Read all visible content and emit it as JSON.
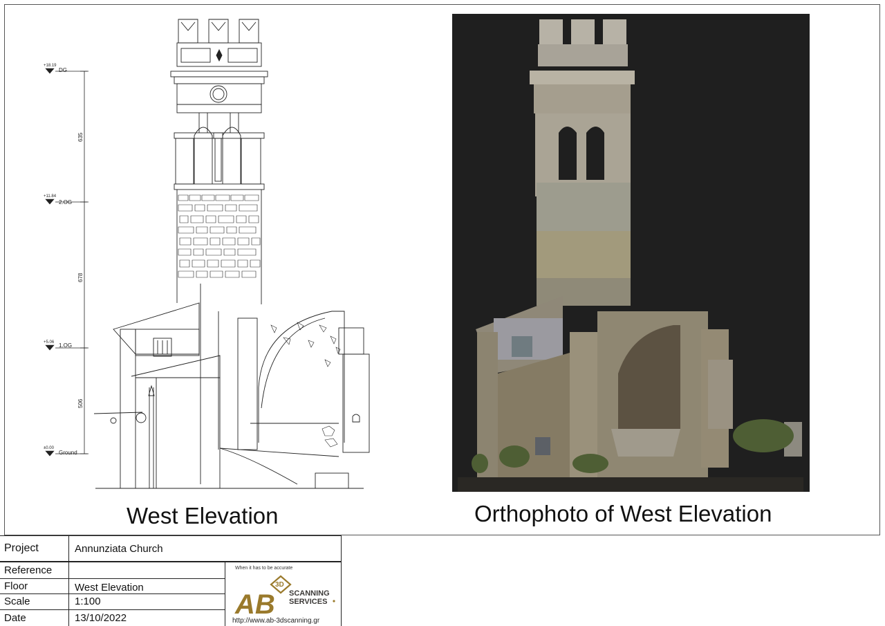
{
  "drawing": {
    "left_caption": "West Elevation",
    "right_caption": "Orthophoto of West  Elevation",
    "levels": [
      {
        "elev": "+18.19",
        "name": "DG"
      },
      {
        "elev": "+11.84",
        "name": "2.OG"
      },
      {
        "elev": "+5.06",
        "name": "1.OG"
      },
      {
        "elev": "±0.00",
        "name": "Ground"
      }
    ],
    "dimensions": [
      "635",
      "678",
      "506"
    ]
  },
  "titleblock": {
    "rows": [
      {
        "label": "Project",
        "value": "Annunziata Church"
      },
      {
        "label": "Reference",
        "value": ""
      },
      {
        "label": "Floor",
        "value": "West Elevation"
      },
      {
        "label": "Scale",
        "value": "1:100"
      },
      {
        "label": "Date",
        "value": "13/10/2022"
      }
    ]
  },
  "logo": {
    "tagline": "When it has to be accurate",
    "mark": "AB",
    "badge": "3D",
    "line1": "SCANNING",
    "line2": "SERVICES",
    "url": "http://www.ab-3dscanning.gr",
    "gold": "#9a7a2c",
    "dark": "#3c3a38"
  }
}
